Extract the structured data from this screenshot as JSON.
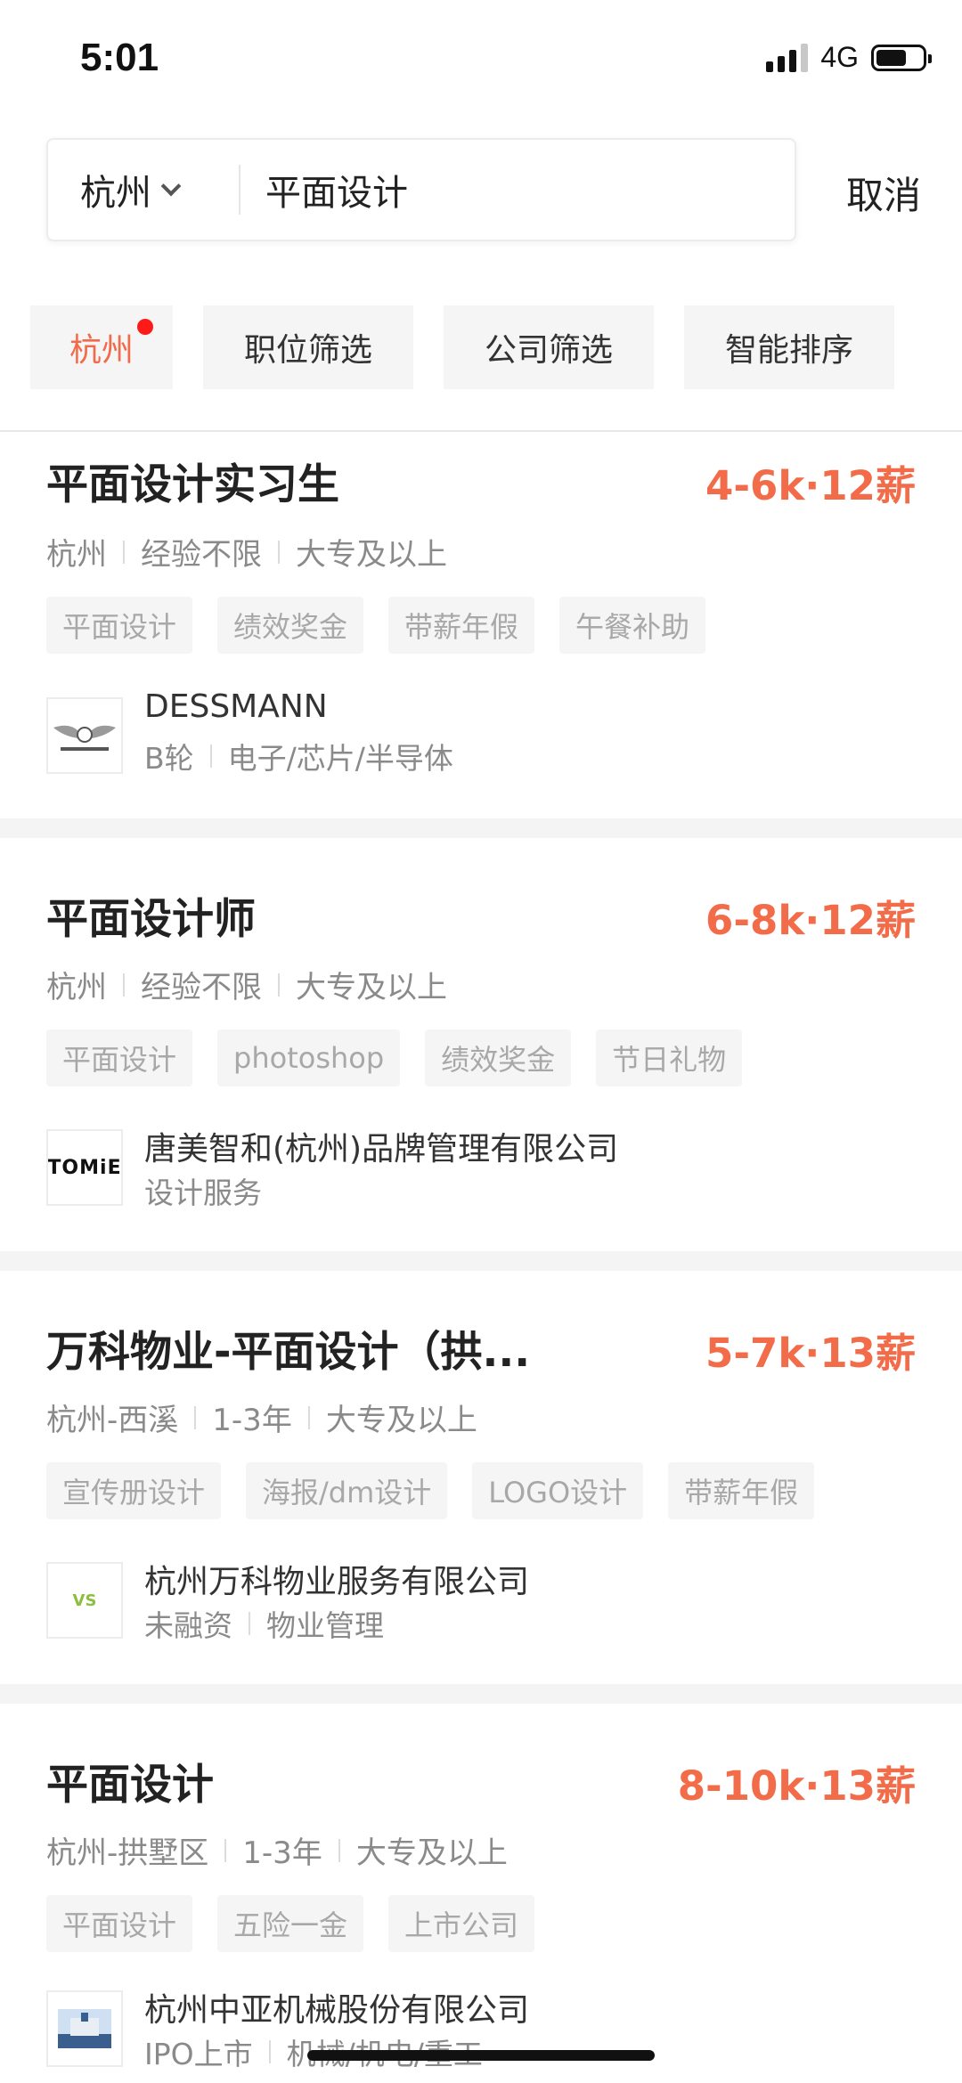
{
  "status_bar": {
    "time": "5:01",
    "network": "4G"
  },
  "search": {
    "city": "杭州",
    "query": "平面设计",
    "cancel_label": "取消"
  },
  "filters": [
    {
      "label": "杭州",
      "active": true
    },
    {
      "label": "职位筛选",
      "active": false
    },
    {
      "label": "公司筛选",
      "active": false
    },
    {
      "label": "智能排序",
      "active": false
    }
  ],
  "colors": {
    "accent": "#f36c4a",
    "badge": "#ff1a1a",
    "tag_bg": "#f5f5f5"
  },
  "jobs": [
    {
      "title": "平面设计实习生",
      "salary": "4-6k·12薪",
      "meta": [
        "杭州",
        "经验不限",
        "大专及以上"
      ],
      "tags": [
        "平面设计",
        "绩效奖金",
        "带薪年假",
        "午餐补助"
      ],
      "company": {
        "name": "DESSMANN",
        "info": [
          "B轮",
          "电子/芯片/半导体"
        ],
        "logo_icon": "dessmann-logo",
        "logo_text": "DESSMANN"
      }
    },
    {
      "title": "平面设计师",
      "salary": "6-8k·12薪",
      "meta": [
        "杭州",
        "经验不限",
        "大专及以上"
      ],
      "tags": [
        "平面设计",
        "photoshop",
        "绩效奖金",
        "节日礼物"
      ],
      "company": {
        "name": "唐美智和(杭州)品牌管理有限公司",
        "info": [
          "设计服务"
        ],
        "logo_icon": "tome-logo",
        "logo_text": "TOMiE"
      }
    },
    {
      "title": "万科物业-平面设计（拱...",
      "salary": "5-7k·13薪",
      "meta": [
        "杭州-西溪",
        "1-3年",
        "大专及以上"
      ],
      "tags": [
        "宣传册设计",
        "海报/dm设计",
        "LOGO设计",
        "带薪年假"
      ],
      "company": {
        "name": "杭州万科物业服务有限公司",
        "info": [
          "未融资",
          "物业管理"
        ],
        "logo_icon": "vanke-logo",
        "logo_text": "VS"
      }
    },
    {
      "title": "平面设计",
      "salary": "8-10k·13薪",
      "meta": [
        "杭州-拱墅区",
        "1-3年",
        "大专及以上"
      ],
      "tags": [
        "平面设计",
        "五险一金",
        "上市公司"
      ],
      "company": {
        "name": "杭州中亚机械股份有限公司",
        "info": [
          "IPO上市",
          "机械/机电/重工"
        ],
        "logo_icon": "zhongya-logo",
        "logo_text": ""
      }
    }
  ]
}
